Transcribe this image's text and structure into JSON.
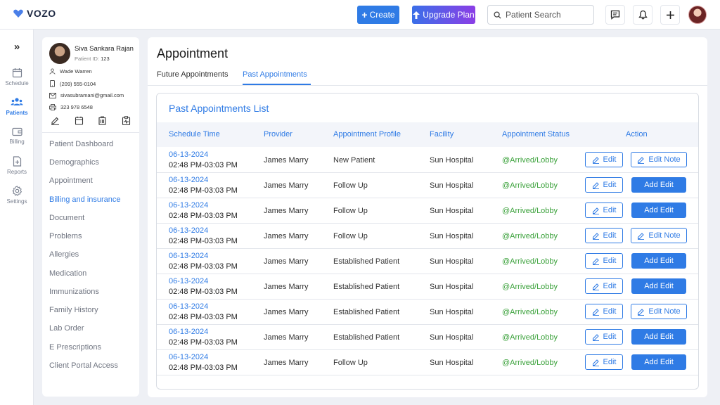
{
  "app": {
    "brand": "VOZO"
  },
  "topbar": {
    "create_label": "Create",
    "upgrade_label": "Upgrade Plan",
    "search_placeholder": "Patient Search"
  },
  "rail": {
    "items": [
      {
        "label": "Schedule",
        "icon": "calendar-icon"
      },
      {
        "label": "Patients",
        "icon": "users-icon"
      },
      {
        "label": "Billing",
        "icon": "wallet-icon"
      },
      {
        "label": "Reports",
        "icon": "report-icon"
      },
      {
        "label": "Settings",
        "icon": "gear-icon"
      }
    ]
  },
  "patient": {
    "name": "Siva Sankara Rajan",
    "id_label": "Patient ID:",
    "id_value": "123",
    "contact_name": "Wade Warren",
    "phone": "(209) 555-0104",
    "email": "sivasubramani@gmail.com",
    "fax": "323 978 6548"
  },
  "side_menu": [
    "Patient Dashboard",
    "Demographics",
    "Appointment",
    "Billing and insurance",
    "Document",
    "Problems",
    "Allergies",
    "Medication",
    "Immunizations",
    "Family History",
    "Lab Order",
    "E Prescriptions",
    "Client Portal Access"
  ],
  "main": {
    "title": "Appointment",
    "tabs": [
      "Future Appointments",
      "Past Appointments"
    ],
    "active_tab": "Past Appointments",
    "list_title": "Past Appointments List",
    "columns": [
      "Schedule Time",
      "Provider",
      "Appointment Profile",
      "Facility",
      "Appointment Status",
      "Action"
    ],
    "edit_label": "Edit",
    "edit_note_label": "Edit Note",
    "add_edit_label": "Add Edit",
    "rows": [
      {
        "date": "06-13-2024",
        "time": "02:48 PM-03:03 PM",
        "provider": "James Marry",
        "profile": "New Patient",
        "facility": "Sun Hospital",
        "status": "@Arrived/Lobby",
        "note_action": "edit_note"
      },
      {
        "date": "06-13-2024",
        "time": "02:48 PM-03:03 PM",
        "provider": "James Marry",
        "profile": "Follow Up",
        "facility": "Sun Hospital",
        "status": "@Arrived/Lobby",
        "note_action": "add_edit"
      },
      {
        "date": "06-13-2024",
        "time": "02:48 PM-03:03 PM",
        "provider": "James Marry",
        "profile": "Follow Up",
        "facility": "Sun Hospital",
        "status": "@Arrived/Lobby",
        "note_action": "add_edit"
      },
      {
        "date": "06-13-2024",
        "time": "02:48 PM-03:03 PM",
        "provider": "James Marry",
        "profile": "Follow Up",
        "facility": "Sun Hospital",
        "status": "@Arrived/Lobby",
        "note_action": "edit_note"
      },
      {
        "date": "06-13-2024",
        "time": "02:48 PM-03:03 PM",
        "provider": "James Marry",
        "profile": "Established Patient",
        "facility": "Sun Hospital",
        "status": "@Arrived/Lobby",
        "note_action": "add_edit"
      },
      {
        "date": "06-13-2024",
        "time": "02:48 PM-03:03 PM",
        "provider": "James Marry",
        "profile": "Established Patient",
        "facility": "Sun Hospital",
        "status": "@Arrived/Lobby",
        "note_action": "add_edit"
      },
      {
        "date": "06-13-2024",
        "time": "02:48 PM-03:03 PM",
        "provider": "James Marry",
        "profile": "Established Patient",
        "facility": "Sun Hospital",
        "status": "@Arrived/Lobby",
        "note_action": "edit_note"
      },
      {
        "date": "06-13-2024",
        "time": "02:48 PM-03:03 PM",
        "provider": "James Marry",
        "profile": "Established Patient",
        "facility": "Sun Hospital",
        "status": "@Arrived/Lobby",
        "note_action": "add_edit"
      },
      {
        "date": "06-13-2024",
        "time": "02:48 PM-03:03 PM",
        "provider": "James Marry",
        "profile": "Follow Up",
        "facility": "Sun Hospital",
        "status": "@Arrived/Lobby",
        "note_action": "add_edit"
      }
    ]
  },
  "colors": {
    "accent": "#2f7be5",
    "status_green": "#3aa13a",
    "upgrade_gradient_start": "#3a6fe8",
    "upgrade_gradient_end": "#8b3ee6"
  }
}
